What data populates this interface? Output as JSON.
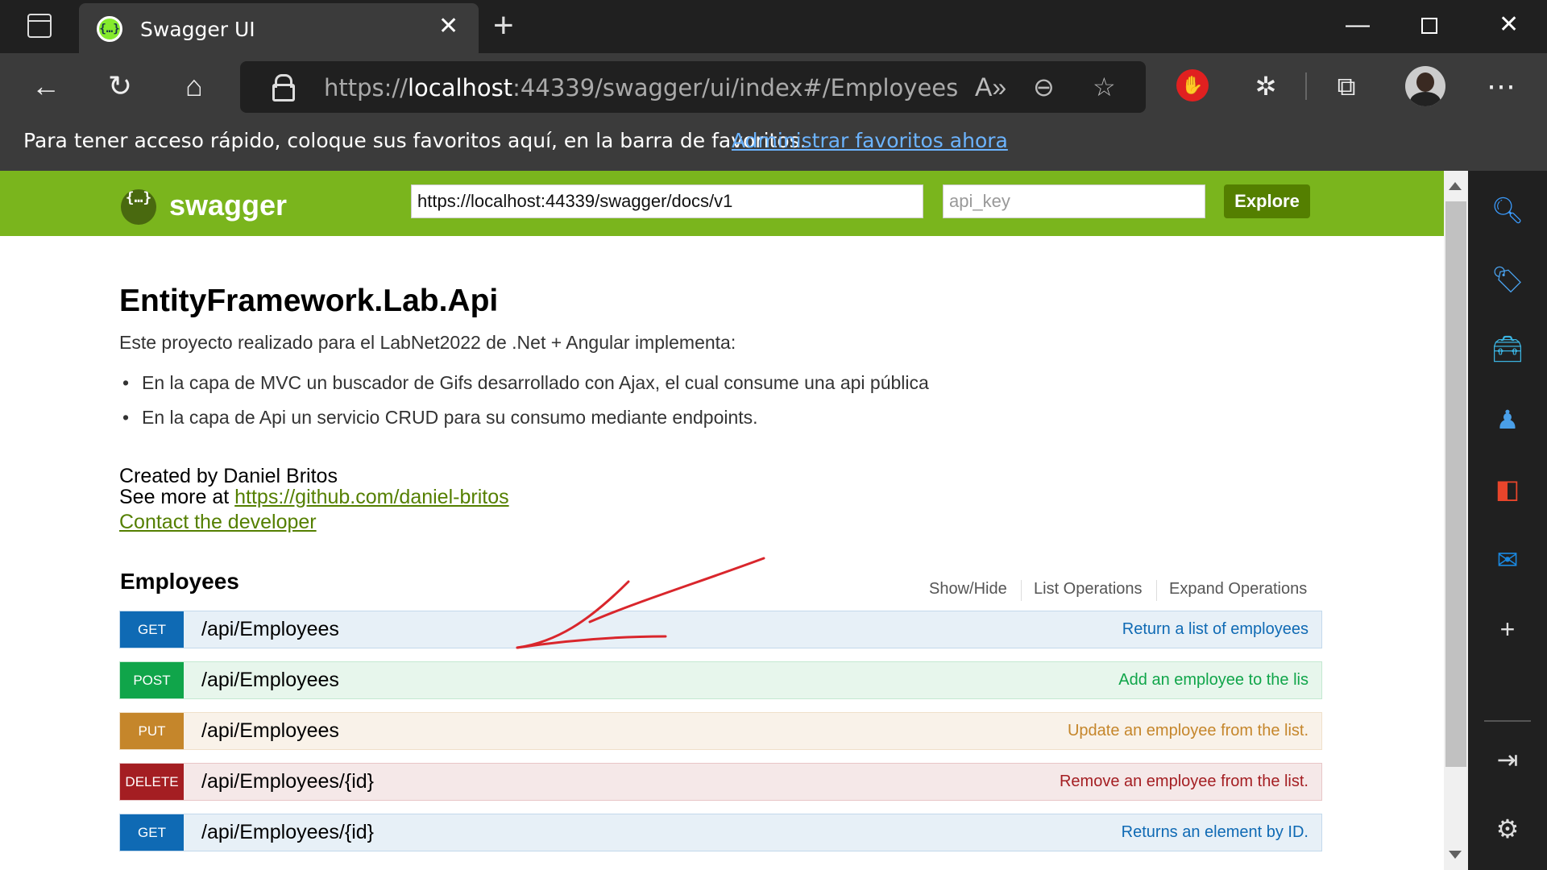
{
  "browser": {
    "tab_title": "Swagger UI",
    "tab_icon_glyph": "{…}",
    "url_prefix": "https://",
    "url_host": "localhost",
    "url_rest": ":44339/swagger/ui/index#/Employees",
    "favorites_message": "Para tener acceso rápido, coloque sus favoritos aquí, en la barra de favoritos.",
    "favorites_link": "Administrar favoritos ahora",
    "blocker_badge": "✋"
  },
  "swagger": {
    "logo_glyph": "{…}",
    "logo_text": "swagger",
    "spec_url": "https://localhost:44339/swagger/docs/v1",
    "api_key_placeholder": "api_key",
    "explore_label": "Explore"
  },
  "info": {
    "title": "EntityFramework.Lab.Api",
    "description": "Este proyecto realizado para el LabNet2022 de .Net + Angular implementa:",
    "bullets": [
      "En la capa de MVC un buscador de Gifs desarrollado con Ajax, el cual consume una api pública",
      "En la capa de Api un servicio CRUD para su consumo mediante endpoints."
    ],
    "created_by": "Created by Daniel Britos",
    "see_more_prefix": "See more at ",
    "see_more_link": "https://github.com/daniel-britos",
    "contact": "Contact the developer"
  },
  "resource": {
    "name": "Employees",
    "show_hide": "Show/Hide",
    "list_operations": "List Operations",
    "expand_operations": "Expand Operations"
  },
  "operations": [
    {
      "method": "GET",
      "path": "/api/Employees",
      "summary": "Return a list of employees"
    },
    {
      "method": "POST",
      "path": "/api/Employees",
      "summary": "Add an employee to the lis"
    },
    {
      "method": "PUT",
      "path": "/api/Employees",
      "summary": "Update an employee from the list."
    },
    {
      "method": "DELETE",
      "path": "/api/Employees/{id}",
      "summary": "Remove an employee from the list."
    },
    {
      "method": "GET",
      "path": "/api/Employees/{id}",
      "summary": "Returns an element by ID."
    }
  ],
  "colors": {
    "swagger_green": "#7ab51d",
    "get": "#0f6ab4",
    "post": "#10a54a",
    "put": "#c5862b",
    "delete": "#a41e22",
    "annotation_arrow": "#d9262c"
  },
  "icons": {
    "tabs": "tab-actions-icon",
    "back": "back-arrow-icon",
    "refresh": "refresh-icon",
    "home": "home-icon",
    "read_aloud": "read-aloud-icon",
    "zoom": "zoom-out-icon",
    "favorite": "add-favorite-icon",
    "extensions": "extensions-icon",
    "collections": "collections-icon",
    "more": "more-icon",
    "sidebar": [
      "search-icon",
      "shopping-tag-icon",
      "tools-icon",
      "games-icon",
      "office-icon",
      "outlook-icon",
      "add-icon",
      "exit-sidebar-icon",
      "settings-icon"
    ]
  }
}
